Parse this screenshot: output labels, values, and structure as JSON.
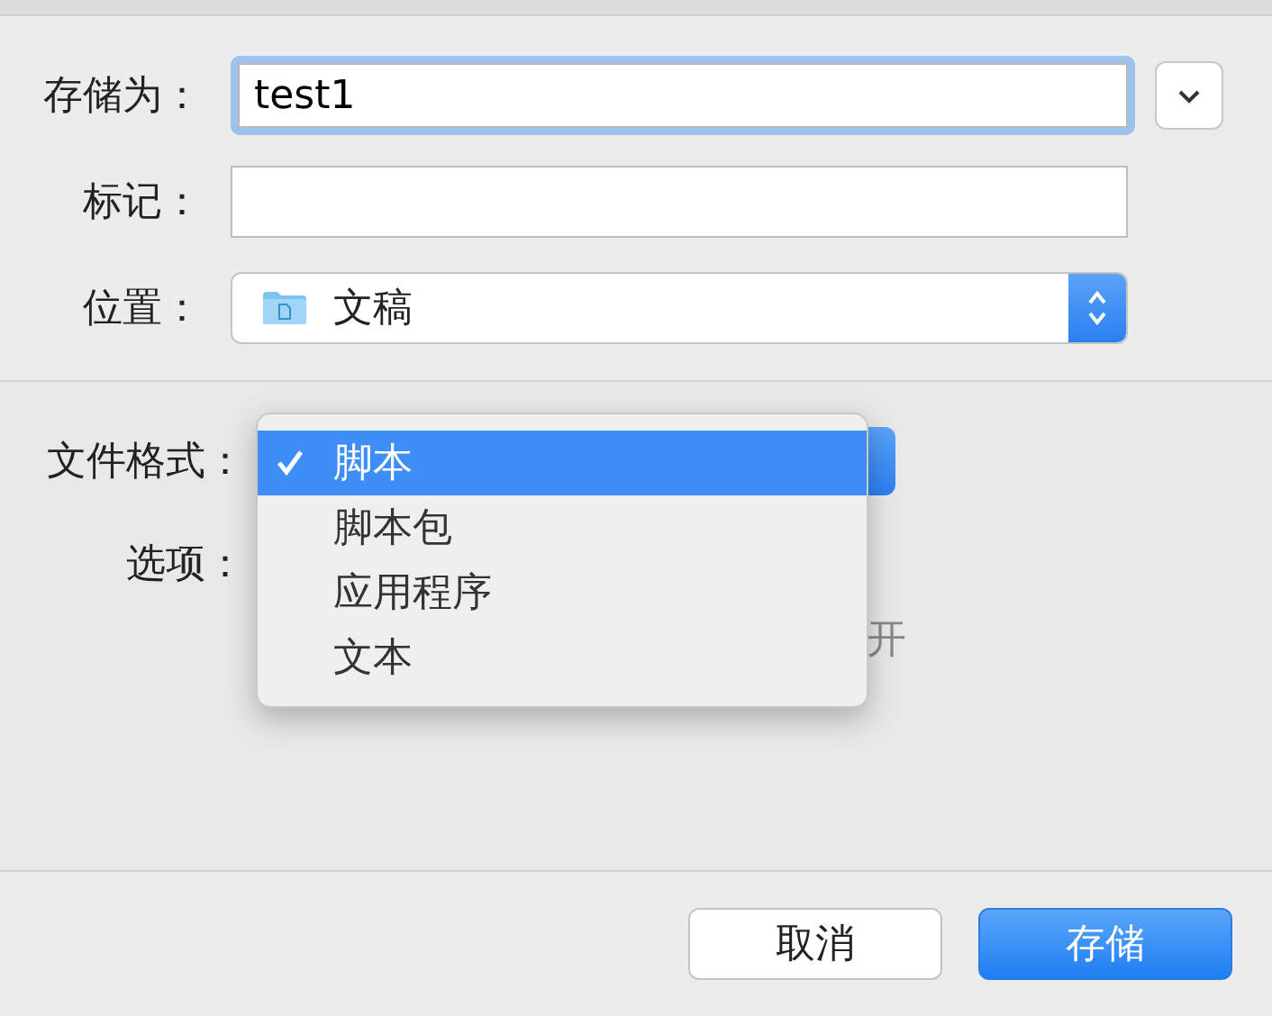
{
  "save_as": {
    "label": "存储为：",
    "value": "test1"
  },
  "tags": {
    "label": "标记："
  },
  "location": {
    "label": "位置：",
    "value": "文稿"
  },
  "format": {
    "label": "文件格式：",
    "menu": [
      {
        "label": "脚本",
        "selected": true
      },
      {
        "label": "脚本包",
        "selected": false
      },
      {
        "label": "应用程序",
        "selected": false
      },
      {
        "label": "文本",
        "selected": false
      }
    ]
  },
  "options": {
    "label": "选项：",
    "partial_text": "开"
  },
  "buttons": [
    {
      "label": "取消",
      "kind": "cancel"
    },
    {
      "label": "存储",
      "kind": "default"
    }
  ]
}
